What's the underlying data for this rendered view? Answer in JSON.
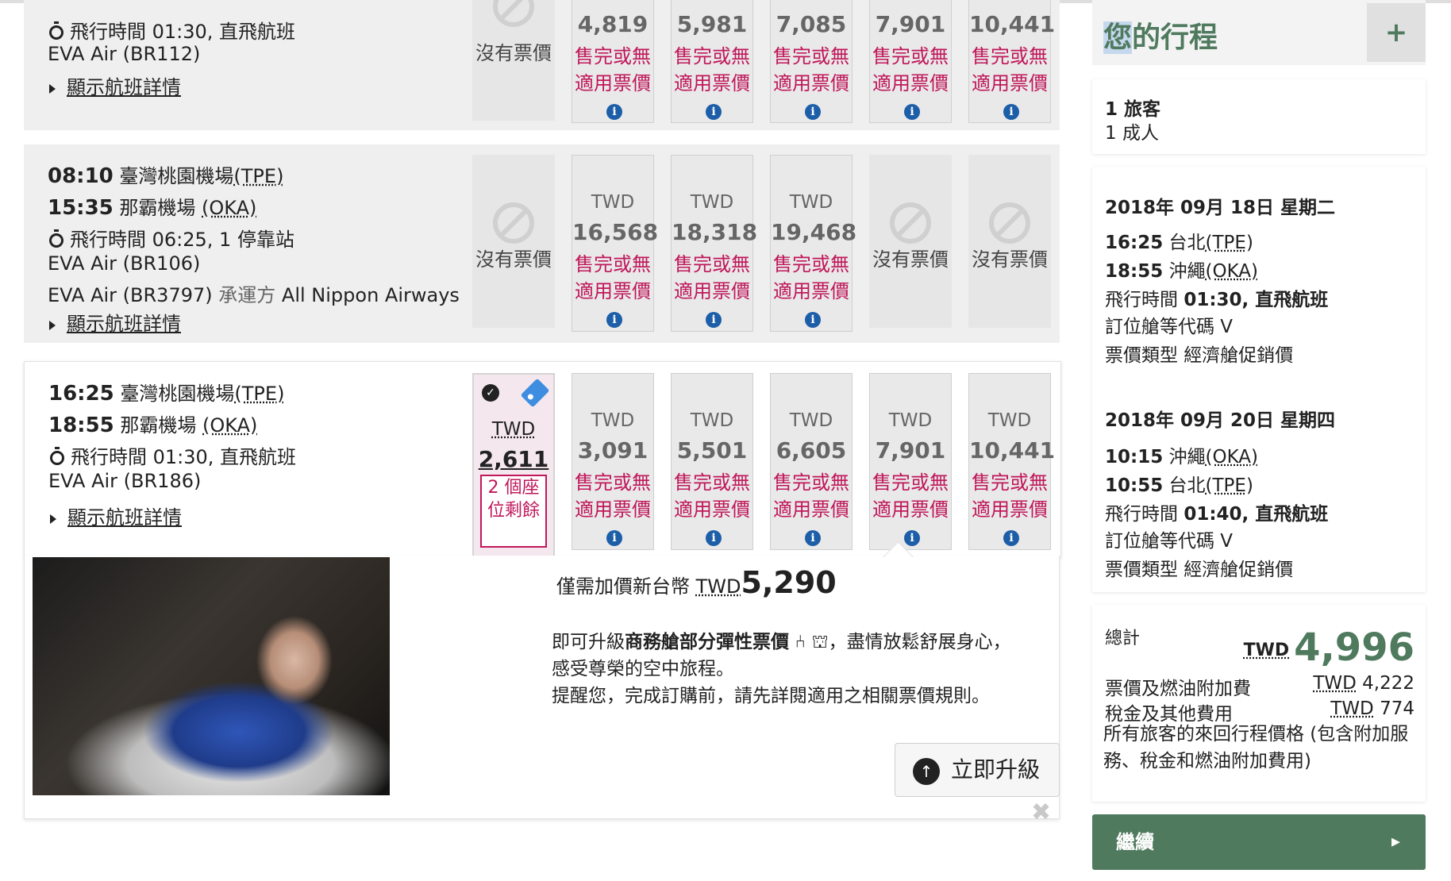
{
  "rows": [
    {
      "duration": "飛行時間 01:30, 直飛航班",
      "carrier": "EVA Air (BR112)",
      "details_link": "顯示航班詳情",
      "cells": [
        {
          "na": true,
          "label": "沒有票價"
        },
        {
          "amount": "4,819",
          "status": "售完或無適用票價"
        },
        {
          "amount": "5,981",
          "status": "售完或無適用票價"
        },
        {
          "amount": "7,085",
          "status": "售完或無適用票價"
        },
        {
          "amount": "7,901",
          "status": "售完或無適用票價"
        },
        {
          "amount": "10,441",
          "status": "售完或無適用票價"
        }
      ]
    },
    {
      "dep_time": "08:10",
      "dep_airport": "臺灣桃園機場",
      "dep_code": "(TPE)",
      "arr_time": "15:35",
      "arr_airport": "那霸機場",
      "arr_code": "(OKA)",
      "duration": "飛行時間 06:25, 1 停靠站",
      "carrier": "EVA Air (BR106)",
      "carrier2": "EVA Air (BR3797)",
      "operated_by": "承運方",
      "operator": "All Nippon Airways",
      "details_link": "顯示航班詳情",
      "cells": [
        {
          "na": true,
          "label": "沒有票價"
        },
        {
          "currency": "TWD",
          "amount": "16,568",
          "status": "售完或無適用票價"
        },
        {
          "currency": "TWD",
          "amount": "18,318",
          "status": "售完或無適用票價"
        },
        {
          "currency": "TWD",
          "amount": "19,468",
          "status": "售完或無適用票價"
        },
        {
          "na": true,
          "label": "沒有票價"
        },
        {
          "na": true,
          "label": "沒有票價"
        }
      ]
    },
    {
      "dep_time": "16:25",
      "dep_airport": "臺灣桃園機場",
      "dep_code": "(TPE)",
      "arr_time": "18:55",
      "arr_airport": "那霸機場",
      "arr_code": "(OKA)",
      "duration": "飛行時間 01:30, 直飛航班",
      "carrier": "EVA Air (BR186)",
      "details_link": "顯示航班詳情",
      "selected": {
        "currency": "TWD",
        "amount": "2,611",
        "seats": "2 個座位剩餘"
      },
      "cells": [
        {
          "currency": "TWD",
          "amount": "3,091",
          "status": "售完或無適用票價"
        },
        {
          "currency": "TWD",
          "amount": "5,501",
          "status": "售完或無適用票價"
        },
        {
          "currency": "TWD",
          "amount": "6,605",
          "status": "售完或無適用票價"
        },
        {
          "currency": "TWD",
          "amount": "7,901",
          "status": "售完或無適用票價"
        },
        {
          "currency": "TWD",
          "amount": "10,441",
          "status": "售完或無適用票價"
        }
      ]
    }
  ],
  "upgrade": {
    "price_prefix": "僅需加價新台幣",
    "currency": "TWD",
    "price": "5,290",
    "line1_a": "即可升級",
    "line1_b": "商務艙部分彈性票價",
    "line1_c": "，盡情放鬆舒展身心，",
    "line2": "感受尊榮的空中旅程。",
    "line3": "提醒您，完成訂購前，請先詳閱適用之相關票價規則。",
    "button": "立即升級"
  },
  "sidebar": {
    "title_first": "您",
    "title_rest": "的行程",
    "add": "+",
    "passengers_count": "1 旅客",
    "passengers_type": "1 成人",
    "outbound": {
      "date": "2018年 09月 18日 星期二",
      "dep_time": "16:25",
      "dep_city": "台北",
      "dep_code": "(TPE)",
      "arr_time": "18:55",
      "arr_city": "沖繩",
      "arr_code": "(OKA)",
      "duration_label": "飛行時間",
      "duration": "01:30, 直飛航班",
      "class_code": "訂位艙等代碼 V",
      "fare_type": "票價類型 經濟艙促銷價"
    },
    "inbound": {
      "date": "2018年 09月 20日 星期四",
      "dep_time": "10:15",
      "dep_city": "沖繩",
      "dep_code": "(OKA)",
      "arr_time": "10:55",
      "arr_city": "台北",
      "arr_code": "(TPE)",
      "duration_label": "飛行時間",
      "duration": "01:40, 直飛航班",
      "class_code": "訂位艙等代碼 V",
      "fare_type": "票價類型 經濟艙促銷價"
    },
    "total_label": "總計",
    "total_currency": "TWD",
    "total": "4,996",
    "fare_label": "票價及燃油附加費",
    "fare_currency": "TWD",
    "fare_value": "4,222",
    "tax_label": "稅金及其他費用",
    "tax_currency": "TWD",
    "tax_value": "774",
    "note": "所有旅客的來回行程價格 (包含附加服務、稅金和燃油附加費用)",
    "continue": "繼續"
  },
  "colors": {
    "brand_green": "#4f7a5e",
    "soldout_red": "#c0175a",
    "info_blue": "#1d5ea8",
    "tag_blue": "#3e8de0"
  }
}
